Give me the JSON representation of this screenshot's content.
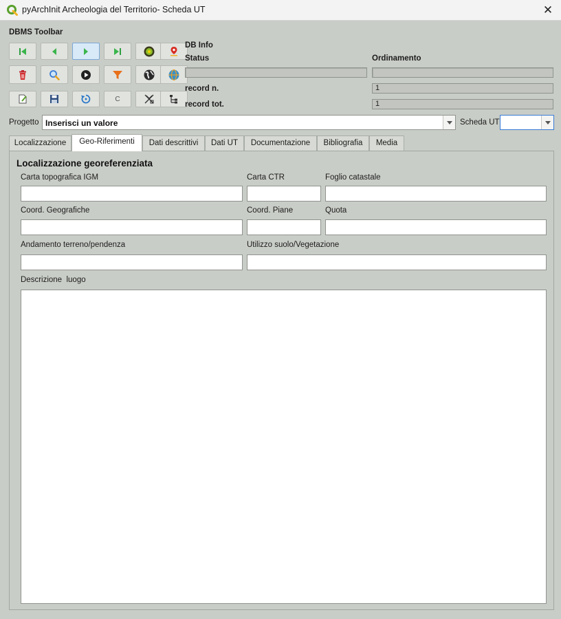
{
  "window": {
    "title": "pyArchInit Archeologia del Territorio- Scheda UT",
    "close_glyph": "✕"
  },
  "toolbar": {
    "title": "DBMS Toolbar",
    "icons": [
      "first-record",
      "previous-record",
      "next-record",
      "last-record",
      "gis-layer",
      "map-pin",
      "delete",
      "search",
      "play",
      "filter",
      "globe",
      "web",
      "new-record",
      "save",
      "reload",
      "c-button",
      "sort",
      "tree-export"
    ],
    "c_label": "C"
  },
  "db_info": {
    "title": "DB Info",
    "status_label": "Status",
    "ordinamento_label": "Ordinamento",
    "record_n_label": "record n.",
    "record_n_value": "1",
    "record_tot_label": "record tot.",
    "record_tot_value": "1"
  },
  "progetto": {
    "label": "Progetto",
    "value": "Inserisci un valore"
  },
  "scheda_ut": {
    "label": "Scheda UT",
    "value": ""
  },
  "tabs": [
    "Localizzazione",
    "Geo-Riferimenti",
    "Dati descrittivi",
    "Dati UT",
    "Documentazione",
    "Bibliografia",
    "Media"
  ],
  "active_tab": "Geo-Riferimenti",
  "form": {
    "section_title": "Localizzazione georeferenziata",
    "carta_igm_label": "Carta topografica IGM",
    "carta_ctr_label": "Carta CTR",
    "foglio_catastale_label": "Foglio catastale",
    "coord_geografiche_label": "Coord. Geografiche",
    "coord_piane_label": "Coord. Piane",
    "quota_label": "Quota",
    "andamento_label": "Andamento terreno/pendenza",
    "utilizzo_label": "Utilizzo suolo/Vegetazione",
    "descrizione_label": "Descrizione  luogo"
  },
  "colors": {
    "window_bg": "#c9cdc7",
    "accent": "#3a7bd5",
    "delete_red": "#c0262c",
    "filter_orange": "#e8701a",
    "qgis_green": "#5aa02c"
  }
}
